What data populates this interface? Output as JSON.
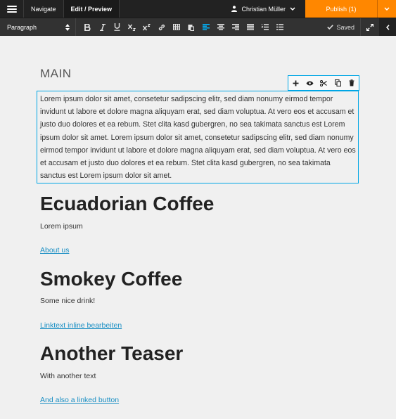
{
  "topbar": {
    "navigate": "Navigate",
    "edit_preview": "Edit / Preview",
    "user": "Christian Müller",
    "publish": "Publish (1)"
  },
  "toolbar": {
    "format": "Paragraph",
    "saved": "Saved",
    "active_tool": "align-left"
  },
  "main": {
    "section_label": "MAIN",
    "paragraph": "Lorem ipsum dolor sit amet, consetetur sadipscing elitr, sed diam nonumy eirmod tempor invidunt ut labore et dolore magna aliquyam erat, sed diam voluptua. At vero eos et accusam et justo duo dolores et ea rebum. Stet clita kasd gubergren, no sea takimata sanctus est Lorem ipsum dolor sit amet. Lorem ipsum dolor sit amet, consetetur sadipscing elitr, sed diam nonumy eirmod tempor invidunt ut labore et dolore magna aliquyam erat, sed diam voluptua. At vero eos et accusam et justo duo dolores et ea rebum. Stet clita kasd gubergren, no sea takimata sanctus est Lorem ipsum dolor sit amet.",
    "teasers": [
      {
        "title": "Ecuadorian Coffee",
        "text": "Lorem ipsum",
        "link": "About us"
      },
      {
        "title": "Smokey Coffee",
        "text": "Some nice drink!",
        "link": "Linktext inline bearbeiten"
      },
      {
        "title": "Another Teaser",
        "text": "With another text",
        "link": "And also a linked button"
      }
    ]
  },
  "colors": {
    "accent": "#00a6e5",
    "publish": "#ff8700",
    "link": "#1a8fc4"
  }
}
